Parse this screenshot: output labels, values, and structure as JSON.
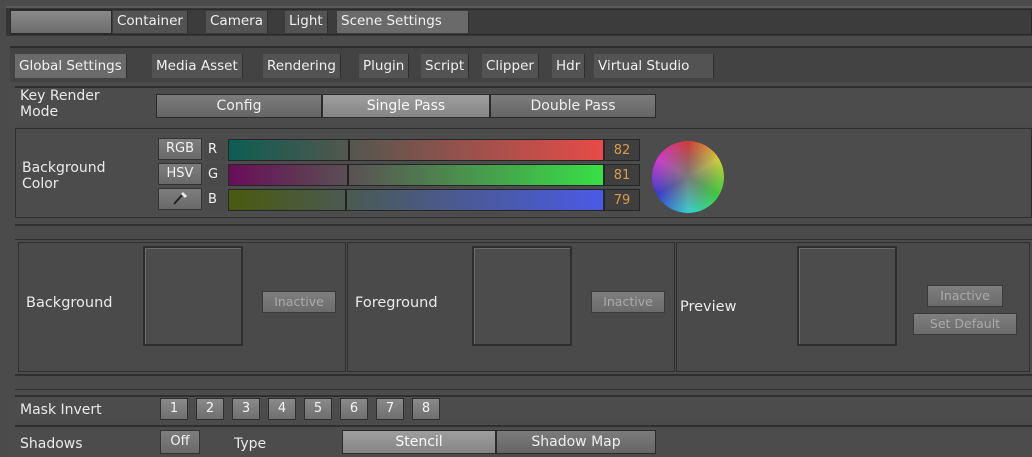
{
  "top_tabs": [
    "Container",
    "Camera",
    "Light",
    "Scene Settings"
  ],
  "sub_tabs": [
    "Global Settings",
    "Media Asset",
    "Rendering",
    "Plugin",
    "Script",
    "Clipper",
    "Hdr",
    "Virtual Studio"
  ],
  "key_render": {
    "label_line1": "Key Render",
    "label_line2": "Mode",
    "options": [
      "Config",
      "Single Pass",
      "Double Pass"
    ],
    "selected": "Single Pass"
  },
  "background_color": {
    "label_line1": "Background",
    "label_line2": "Color",
    "mode_buttons": [
      "RGB",
      "HSV"
    ],
    "eyedropper_icon": "eyedropper-icon",
    "channels": [
      {
        "name": "R",
        "value": "82",
        "level": 0.32
      },
      {
        "name": "G",
        "value": "81",
        "level": 0.32
      },
      {
        "name": "B",
        "value": "79",
        "level": 0.31
      }
    ],
    "color_wheel_icon": "color-wheel-icon"
  },
  "image_slots": [
    {
      "label": "Background",
      "button": "Inactive"
    },
    {
      "label": "Foreground",
      "button": "Inactive"
    },
    {
      "label": "Preview",
      "button": "Inactive",
      "button2": "Set Default"
    }
  ],
  "mask_invert": {
    "label": "Mask Invert",
    "buttons": [
      "1",
      "2",
      "3",
      "4",
      "5",
      "6",
      "7",
      "8"
    ]
  },
  "shadows": {
    "label": "Shadows",
    "toggle": "Off",
    "type_label": "Type",
    "options": [
      "Stencil",
      "Shadow Map"
    ],
    "selected": "Stencil"
  }
}
